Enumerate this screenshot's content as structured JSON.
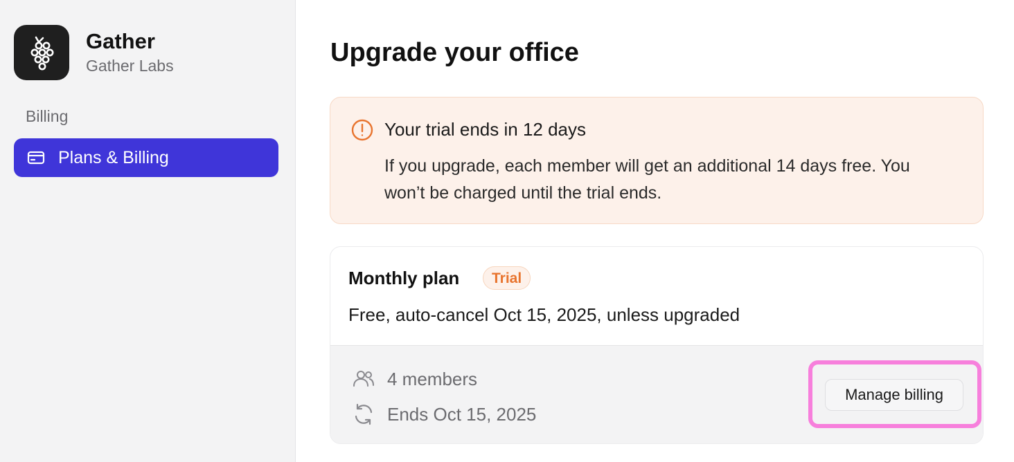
{
  "org": {
    "name": "Gather",
    "subtitle": "Gather Labs",
    "logo_icon": "gather-grapes-logo"
  },
  "sidebar": {
    "section_label": "Billing",
    "items": [
      {
        "label": "Plans & Billing",
        "icon": "credit-card-icon",
        "active": true
      }
    ]
  },
  "main": {
    "title": "Upgrade your office",
    "alert": {
      "icon": "alert-circle-icon",
      "title": "Your trial ends in 12 days",
      "body": "If you upgrade, each member will get an additional 14 days free. You won’t be charged until the trial ends."
    },
    "plan": {
      "name": "Monthly plan",
      "badge": "Trial",
      "description": "Free, auto-cancel Oct 15, 2025, unless upgraded",
      "members": "4 members",
      "ends": "Ends Oct 15, 2025",
      "manage_label": "Manage billing"
    }
  },
  "colors": {
    "accent": "#3f35d9",
    "alert_bg": "#fdf1ea",
    "badge_text": "#e8742e",
    "highlight": "#f77fdc"
  }
}
